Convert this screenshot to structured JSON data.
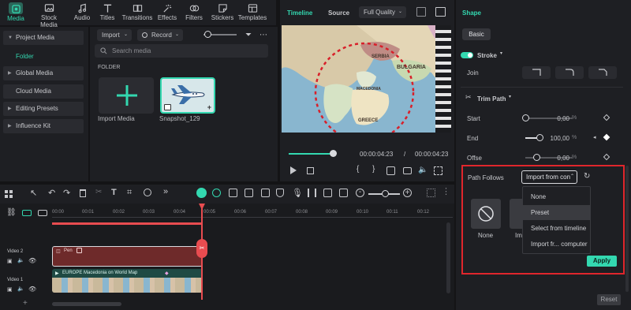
{
  "top_toolbar": {
    "items": [
      {
        "label": "Media",
        "icon": "media-icon",
        "active": true
      },
      {
        "label": "Stock Media",
        "icon": "stock-media-icon"
      },
      {
        "label": "Audio",
        "icon": "music-note-icon"
      },
      {
        "label": "Titles",
        "icon": "text-t-icon"
      },
      {
        "label": "Transitions",
        "icon": "transition-icon"
      },
      {
        "label": "Effects",
        "icon": "effects-icon"
      },
      {
        "label": "Filters",
        "icon": "filters-icon"
      },
      {
        "label": "Stickers",
        "icon": "sticker-icon"
      },
      {
        "label": "Templates",
        "icon": "templates-icon"
      }
    ],
    "accent": "#33d8b0"
  },
  "sidebar": {
    "project_media": "Project Media",
    "folder": "Folder",
    "global_media": "Global Media",
    "cloud_media": "Cloud Media",
    "editing_presets": "Editing Presets",
    "influence_kit": "Influence Kit"
  },
  "media": {
    "import_label": "Import",
    "record_label": "Record",
    "search_placeholder": "Search media",
    "folder_heading": "FOLDER",
    "import_tile_label": "Import Media",
    "snapshot_label": "Snapshot_129"
  },
  "preview": {
    "tab_timeline": "Timeline",
    "tab_source": "Source",
    "quality": "Full Quality",
    "current_time": "00:00:04:23",
    "separator": "/",
    "total_time": "00:00:04:23",
    "map_labels": [
      "SERBIA",
      "BULGARIA",
      "MACEDONIA",
      "GREECE"
    ]
  },
  "properties": {
    "title": "Shape",
    "basic_tab": "Basic",
    "stroke_label": "Stroke",
    "join_label": "Join",
    "trim_path_label": "Trim Path",
    "start_label": "Start",
    "start_value": "0,00",
    "end_label": "End",
    "end_value": "100,00",
    "offset_label": "Offse",
    "offset_value": "0,00",
    "unit": "%",
    "path_follows_label": "Path Follows",
    "path_follows_value": "Import from con",
    "menu_items": [
      "None",
      "Preset",
      "Select from timeline",
      "Import fr... computer"
    ],
    "preset_none_label": "None",
    "preset_other_label": "Im",
    "apply_label": "Apply",
    "reset_label": "Reset",
    "highlight_color": "#e0262c"
  },
  "timeline": {
    "ruler": [
      "00:00",
      "00:01",
      "00:02",
      "00:03",
      "00:04",
      "00:05",
      "00:06",
      "00:07",
      "00:08",
      "00:09",
      "00:10",
      "00:11",
      "00:12"
    ],
    "video2_label": "Video 2",
    "video1_label": "Video 1",
    "clip_pen": "Pen",
    "clip_video": "EUROPE Macedonia on World Map",
    "playhead_color": "#e84c50"
  }
}
